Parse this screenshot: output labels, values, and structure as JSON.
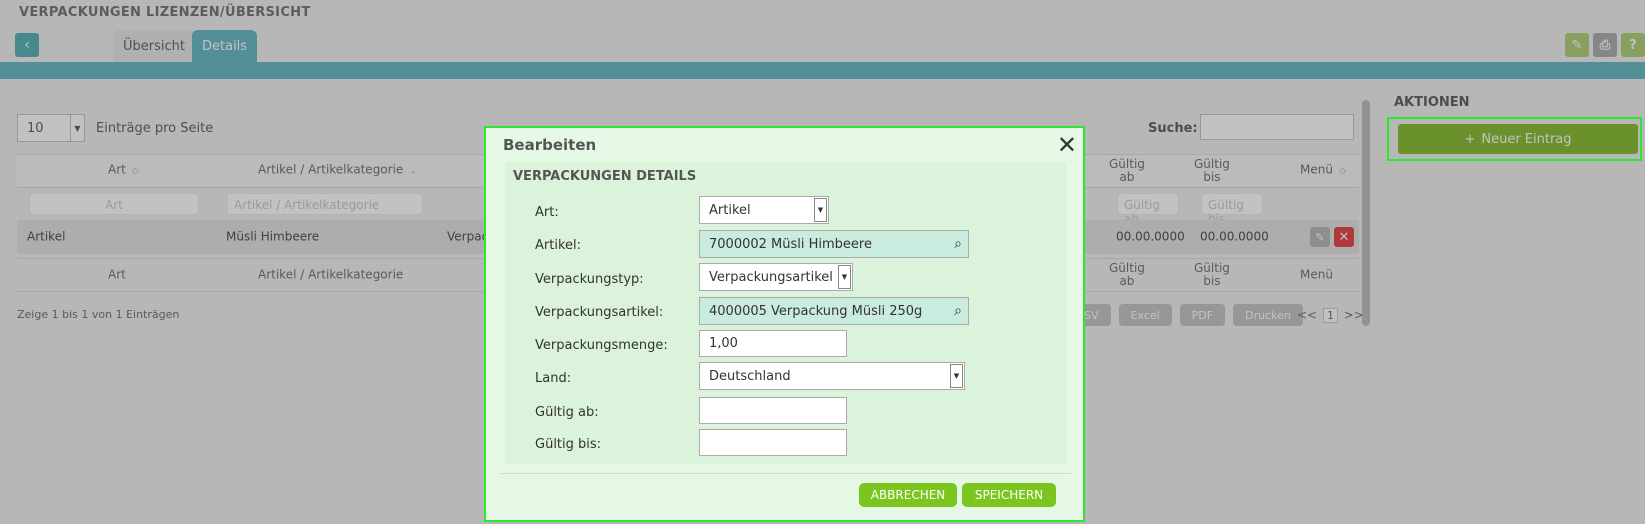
{
  "header": {
    "title": "VERPACKUNGEN LIZENZEN/ÜBERSICHT",
    "back_icon": "chevron-left-icon",
    "tabs": [
      {
        "label": "Übersicht"
      },
      {
        "label": "Details"
      }
    ],
    "icons": {
      "edit": "✎",
      "print": "⎙",
      "help": "?"
    }
  },
  "table": {
    "length_value": "10",
    "length_label": "Einträge pro Seite",
    "search_label": "Suche:",
    "headers": {
      "art": "Art",
      "artikel": "Artikel / Artikelkategorie",
      "gueltig_ab": "Gültig\nab",
      "gueltig_bis": "Gültig\nbis",
      "menu": "Menü"
    },
    "filter_placeholders": {
      "art": "Art",
      "artikel": "Artikel / Artikelkategorie",
      "gueltig_ab": "Gültig ab",
      "gueltig_bis": "Gültig bis"
    },
    "row": {
      "art": "Artikel",
      "artikel": "Müsli Himbeere",
      "verpackung": "Verpac",
      "gueltig_ab": "00.00.0000",
      "gueltig_bis": "00.00.0000"
    },
    "info": "Zeige 1 bis 1 von 1 Einträgen",
    "export_buttons": [
      "SV",
      "Excel",
      "PDF",
      "Drucken"
    ],
    "pager": {
      "prev": "<<",
      "page": "1",
      "next": ">>"
    }
  },
  "actions": {
    "title": "AKTIONEN",
    "new_entry": "Neuer Eintrag",
    "new_entry_icon": "+"
  },
  "modal": {
    "title": "Bearbeiten",
    "close": "✕",
    "panel_title": "VERPACKUNGEN DETAILS",
    "fields": {
      "art": {
        "label": "Art:",
        "value": "Artikel"
      },
      "artikel": {
        "label": "Artikel:",
        "value": "7000002 Müsli Himbeere"
      },
      "verpackungstyp": {
        "label": "Verpackungstyp:",
        "value": "Verpackungsartikel"
      },
      "verpackungsartikel": {
        "label": "Verpackungsartikel:",
        "value": "4000005 Verpackung Müsli 250g"
      },
      "verpackungsmenge": {
        "label": "Verpackungsmenge:",
        "value": "1,00"
      },
      "land": {
        "label": "Land:",
        "value": "Deutschland"
      },
      "gueltig_ab": {
        "label": "Gültig ab:",
        "value": ""
      },
      "gueltig_bis": {
        "label": "Gültig bis:",
        "value": ""
      }
    },
    "cancel": "ABBRECHEN",
    "save": "SPEICHERN"
  },
  "colors": {
    "teal": "#6cbcc5",
    "green_button": "#7ac61f",
    "highlight": "#2ee62e",
    "modal_bg": "#e5f8e5"
  }
}
